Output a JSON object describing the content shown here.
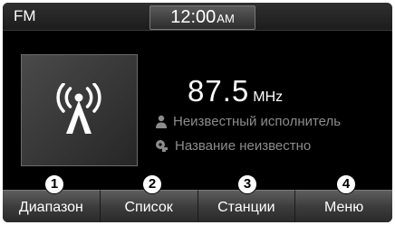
{
  "status_bar": {
    "source": "FM",
    "time": "12:00",
    "ampm": "AM"
  },
  "station": {
    "frequency": "87.5",
    "unit": "MHz",
    "artist": "Неизвестный исполнитель",
    "title": "Название неизвестно"
  },
  "icons": {
    "album_art": "radio-antenna-icon",
    "artist": "person-icon",
    "title": "song-tag-icon"
  },
  "menu": {
    "items": [
      {
        "label": "Диапазон",
        "callout": "1"
      },
      {
        "label": "Список",
        "callout": "2"
      },
      {
        "label": "Станции",
        "callout": "3"
      },
      {
        "label": "Меню",
        "callout": "4"
      }
    ]
  },
  "colors": {
    "screen_bg": "#000000",
    "text_primary": "#ffffff",
    "text_secondary": "#8c8c8c"
  }
}
